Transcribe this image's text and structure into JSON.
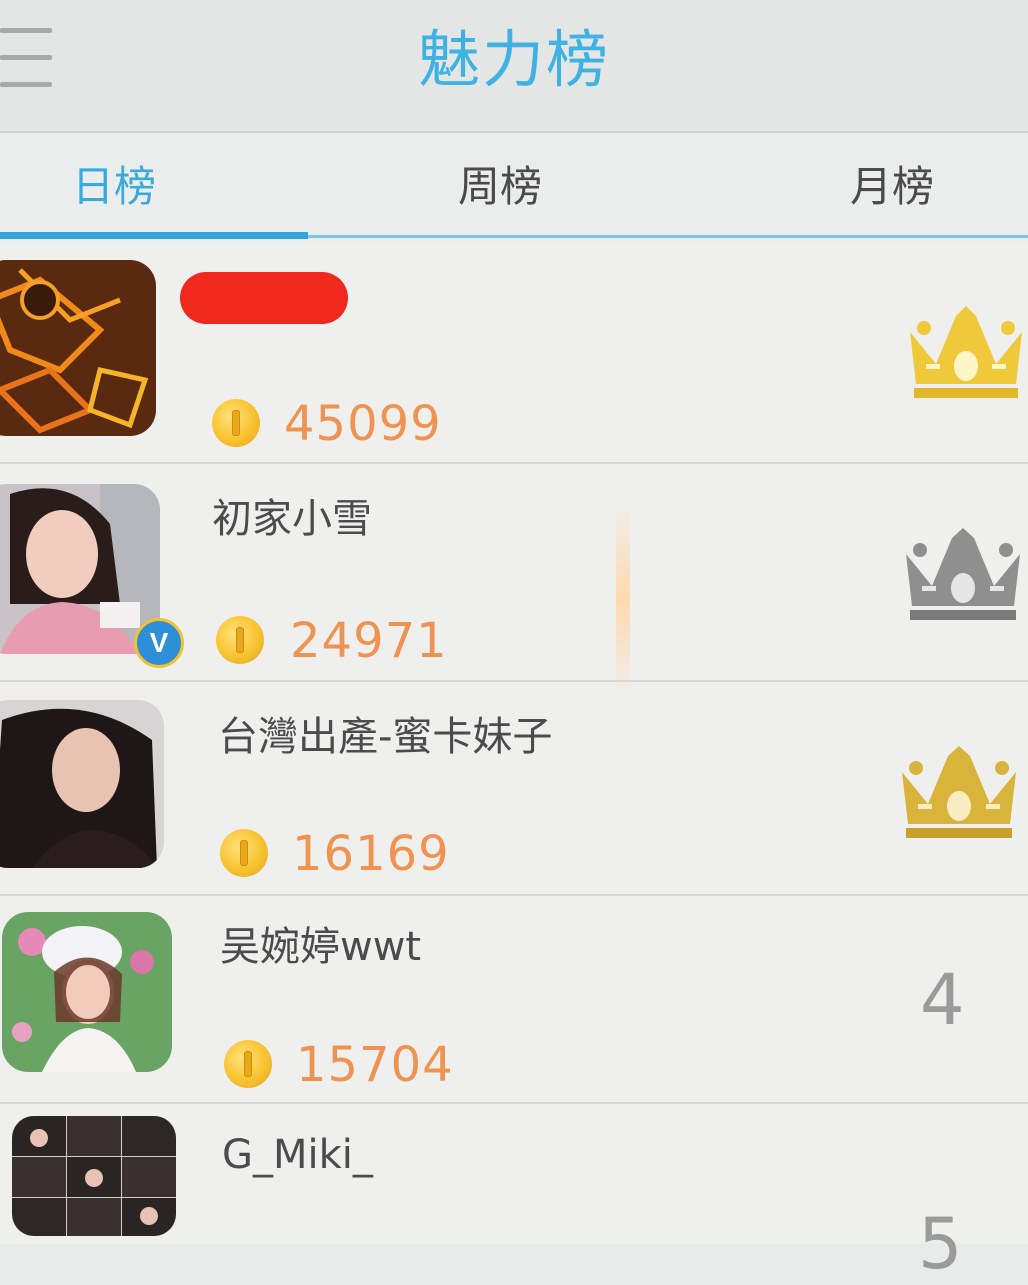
{
  "header": {
    "title": "魅力榜",
    "menu_icon": "hamburger-menu-icon"
  },
  "tabs": [
    {
      "label": "日榜",
      "active": true
    },
    {
      "label": "周榜",
      "active": false
    },
    {
      "label": "月榜",
      "active": false
    }
  ],
  "colors": {
    "accent": "#3aa9dc",
    "score": "#ef9353",
    "crown_gold": "#f0c93a",
    "crown_silver": "#8f8f8f",
    "crown_bronze": "#d9b43a",
    "redaction": "#f0281e"
  },
  "ranking": [
    {
      "rank": 1,
      "name": "",
      "name_redacted": true,
      "score": "45099",
      "coin_icon": "coin-icon",
      "rank_icon": "gold-crown-icon",
      "verified": false
    },
    {
      "rank": 2,
      "name": "初家小雪",
      "score": "24971",
      "coin_icon": "coin-icon",
      "rank_icon": "silver-crown-icon",
      "verified": true,
      "badge": "V"
    },
    {
      "rank": 3,
      "name": "台灣出產-蜜卡妹子",
      "score": "16169",
      "coin_icon": "coin-icon",
      "rank_icon": "bronze-crown-icon",
      "verified": false
    },
    {
      "rank": 4,
      "name": "吴婉婷wwt",
      "score": "15704",
      "coin_icon": "coin-icon",
      "rank_label": "4",
      "verified": false
    },
    {
      "rank": 5,
      "name": "G_Miki_",
      "score": "",
      "coin_icon": "coin-icon",
      "rank_label": "5",
      "verified": false
    }
  ]
}
